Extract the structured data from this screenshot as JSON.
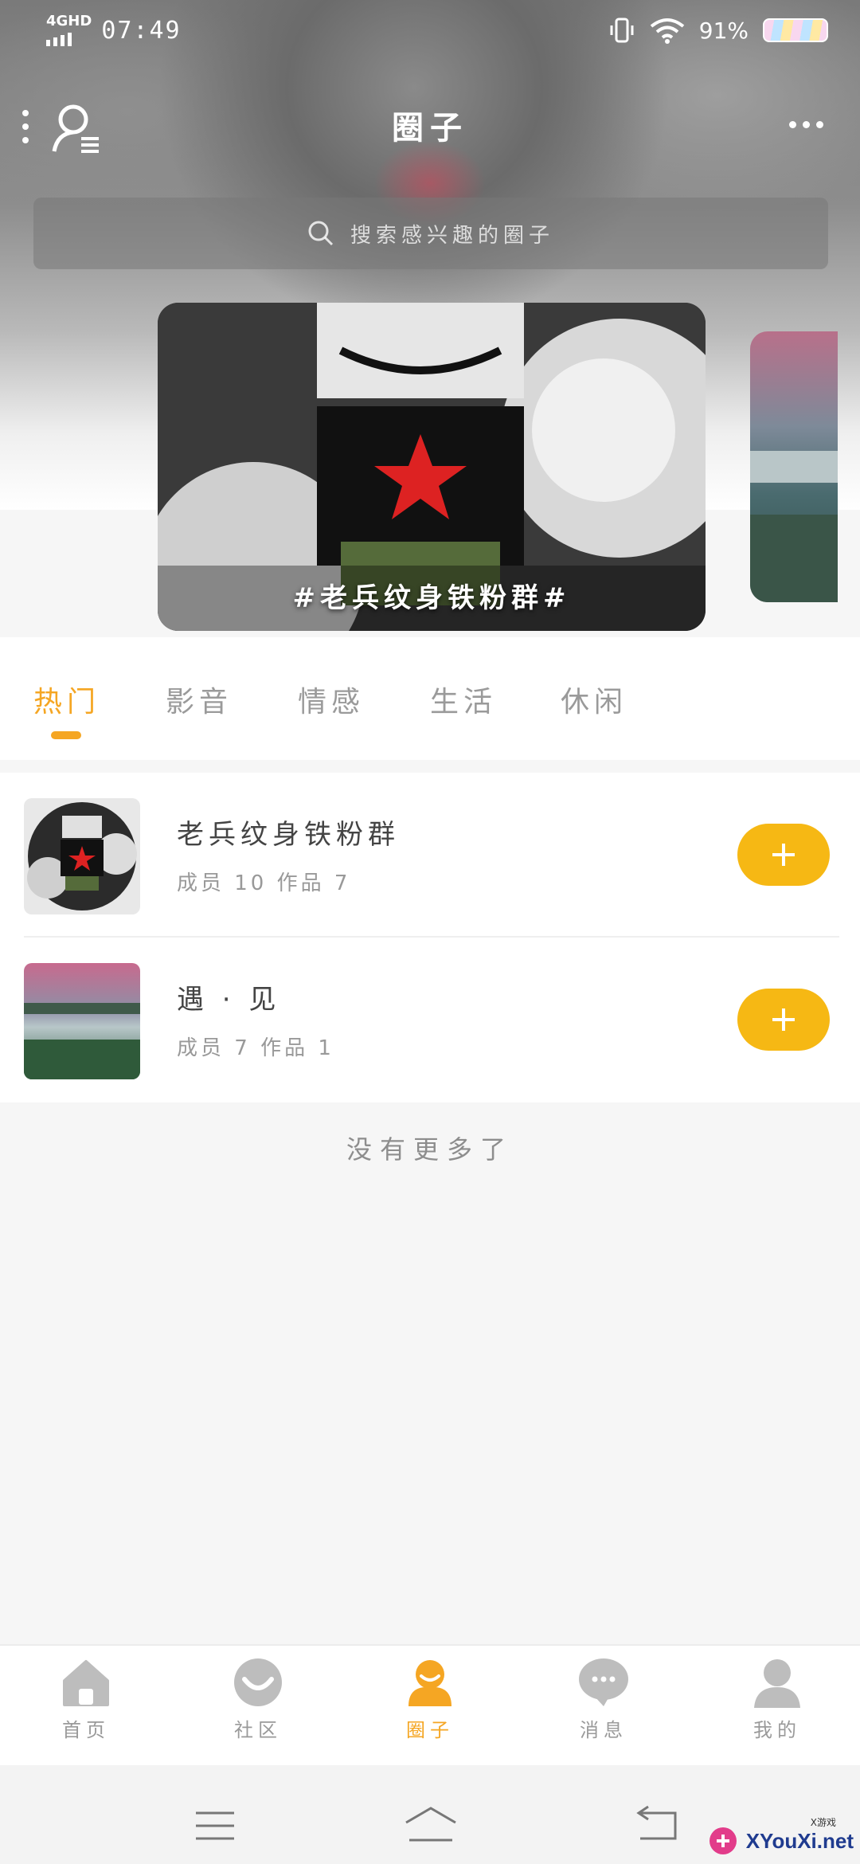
{
  "status_bar": {
    "network": "4GHD",
    "time": "07:49",
    "battery_percent": "91%"
  },
  "header": {
    "title": "圈子",
    "search_placeholder": "搜索感兴趣的圈子"
  },
  "banner": {
    "title": "#老兵纹身铁粉群#"
  },
  "tabs": [
    {
      "label": "热门",
      "active": true
    },
    {
      "label": "影音",
      "active": false
    },
    {
      "label": "情感",
      "active": false
    },
    {
      "label": "生活",
      "active": false
    },
    {
      "label": "休闲",
      "active": false
    }
  ],
  "circles": [
    {
      "name": "老兵纹身铁粉群",
      "meta": "成员 10  作品 7"
    },
    {
      "name": "遇 · 见",
      "meta": "成员 7  作品 1"
    }
  ],
  "list_footer": "没有更多了",
  "bottom_nav": [
    {
      "label": "首页",
      "icon": "home-icon",
      "active": false
    },
    {
      "label": "社区",
      "icon": "community-icon",
      "active": false
    },
    {
      "label": "圈子",
      "icon": "circle-icon",
      "active": true
    },
    {
      "label": "消息",
      "icon": "message-icon",
      "active": false
    },
    {
      "label": "我的",
      "icon": "profile-icon",
      "active": false
    }
  ],
  "watermark": {
    "brand": "XYouXi.net",
    "small": "X游戏"
  },
  "colors": {
    "accent": "#f5a623",
    "join_button": "#f6b814"
  }
}
